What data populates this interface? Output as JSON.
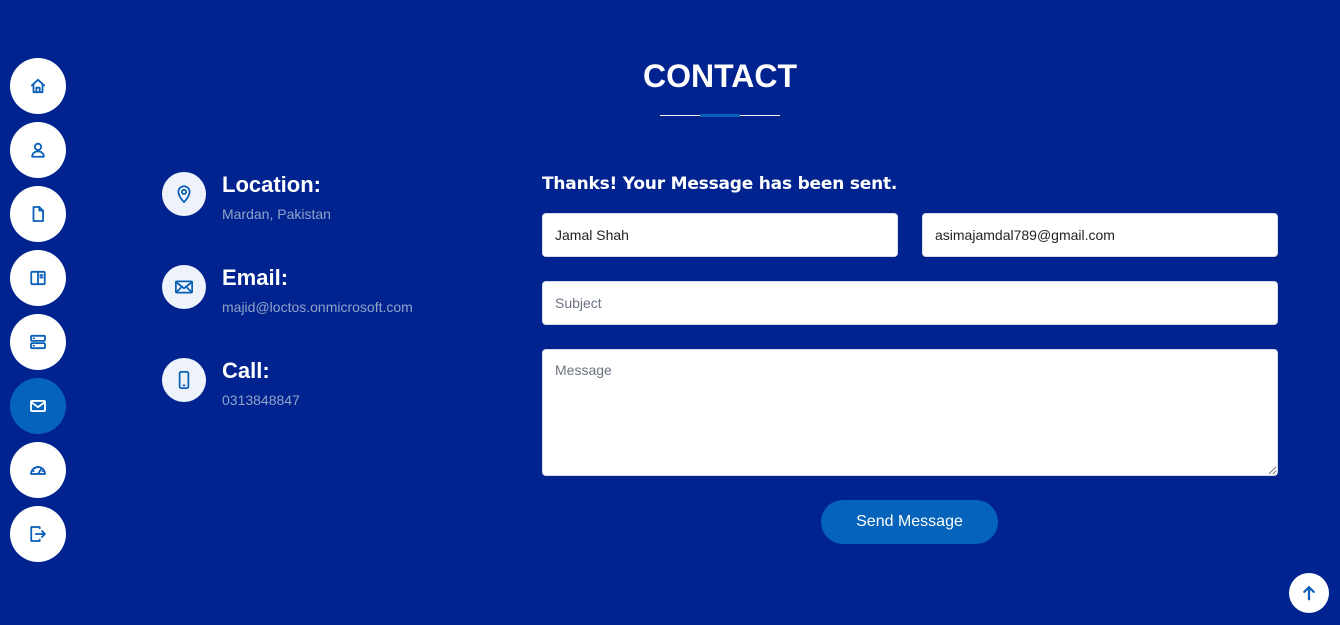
{
  "nav": {
    "items": [
      {
        "icon": "home-icon",
        "active": false
      },
      {
        "icon": "person-icon",
        "active": false
      },
      {
        "icon": "file-icon",
        "active": false
      },
      {
        "icon": "book-icon",
        "active": false
      },
      {
        "icon": "server-icon",
        "active": false
      },
      {
        "icon": "envelope-icon",
        "active": true
      },
      {
        "icon": "speedometer-icon",
        "active": false
      },
      {
        "icon": "logout-icon",
        "active": false
      }
    ]
  },
  "section": {
    "title": "CONTACT"
  },
  "info": {
    "location": {
      "title": "Location:",
      "value": "Mardan, Pakistan",
      "icon": "map-pin-icon"
    },
    "email": {
      "title": "Email:",
      "value": "majid@loctos.onmicrosoft.com",
      "icon": "envelope-icon"
    },
    "call": {
      "title": "Call:",
      "value": "0313848847",
      "icon": "phone-icon"
    }
  },
  "form": {
    "sent_message": "Thanks! Your Message has been sent.",
    "name_value": "Jamal Shah",
    "email_value": "asimajamdal789@gmail.com",
    "subject_placeholder": "Subject",
    "message_placeholder": "Message",
    "submit_label": "Send Message"
  },
  "colors": {
    "background": "#00238f",
    "accent": "#0563bb",
    "icon": "#0b5fb8",
    "muted_text": "#8fa3c9"
  }
}
